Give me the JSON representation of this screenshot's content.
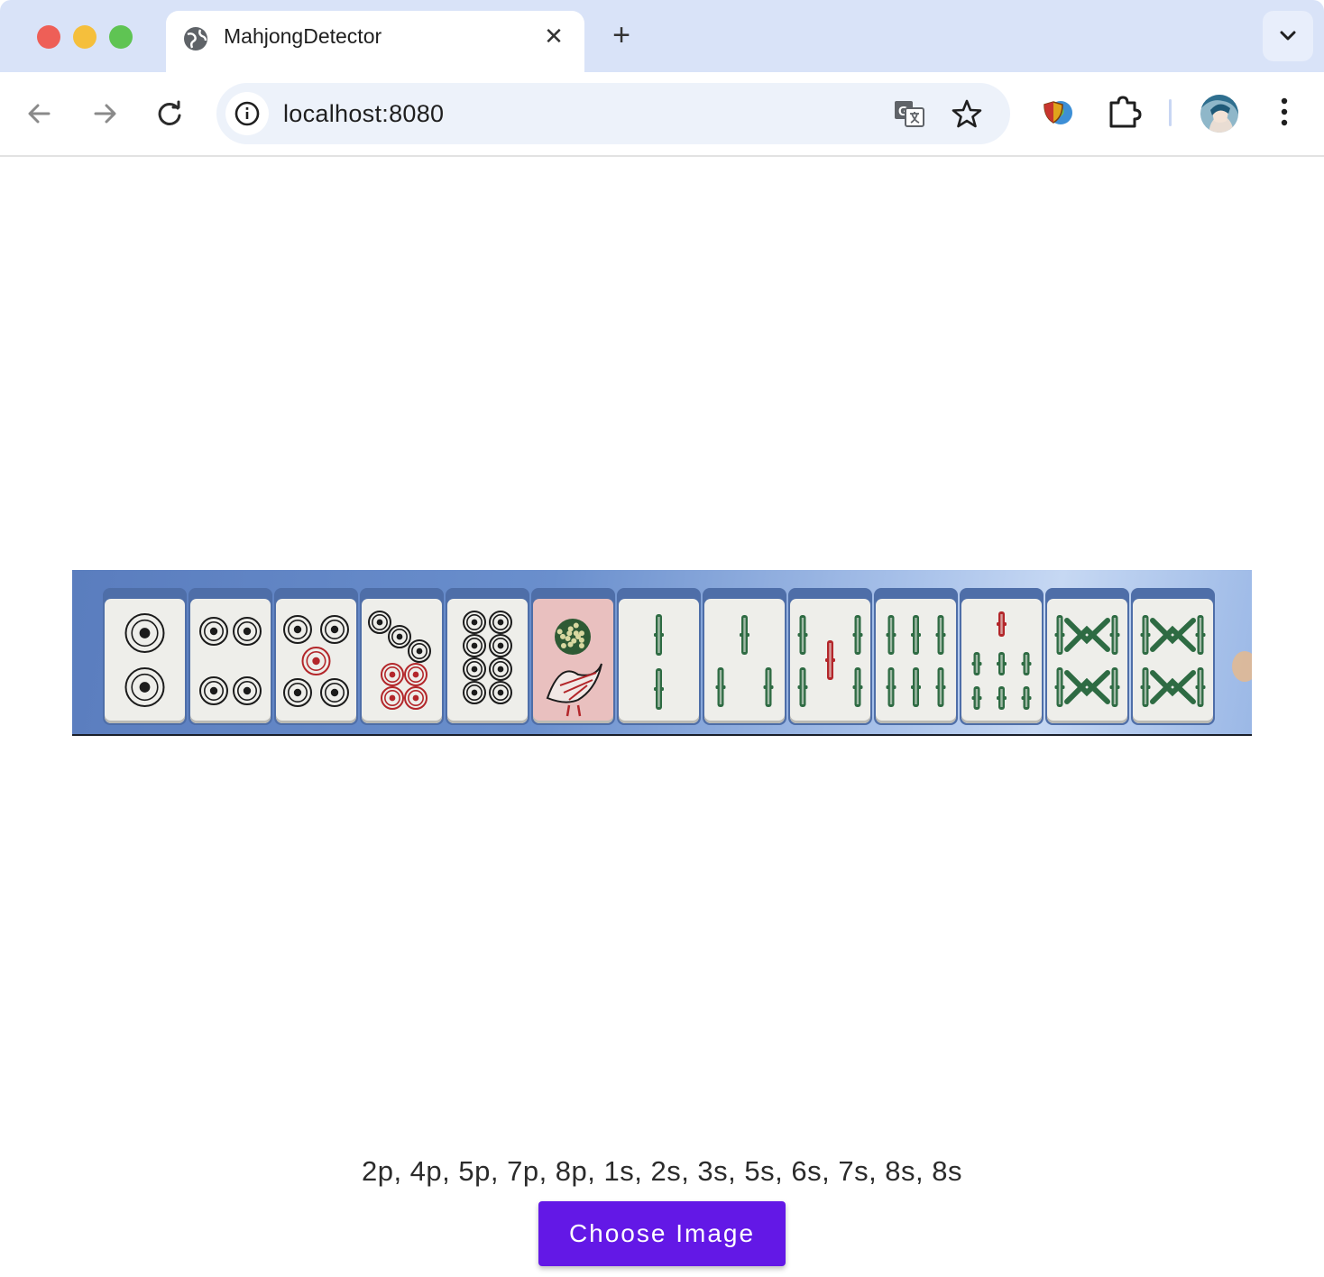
{
  "browser": {
    "tab_title": "MahjongDetector",
    "url": "localhost:8080",
    "icons": [
      "back-arrow-icon",
      "forward-arrow-icon",
      "reload-icon",
      "info-icon",
      "translate-icon",
      "star-icon",
      "extension-shield-icon",
      "puzzle-icon",
      "avatar",
      "kebab-menu-icon",
      "globe-icon",
      "close-icon",
      "plus-icon",
      "chevron-down-icon"
    ]
  },
  "hand": {
    "tiles": [
      "2p",
      "4p",
      "5p",
      "7p",
      "8p",
      "1s",
      "2s",
      "3s",
      "5s",
      "6s",
      "7s",
      "8s",
      "8s"
    ]
  },
  "result": {
    "text": "2p, 4p, 5p, 7p, 8p, 1s, 2s, 3s, 5s, 6s, 7s, 8s, 8s"
  },
  "actions": {
    "choose_label": "Choose Image"
  },
  "colors": {
    "accent": "#6318e6",
    "tab_strip": "#d9e3f8",
    "omnibox": "#edf2fa",
    "bamboo_green": "#2e6b43",
    "pin_red": "#b3262a"
  }
}
